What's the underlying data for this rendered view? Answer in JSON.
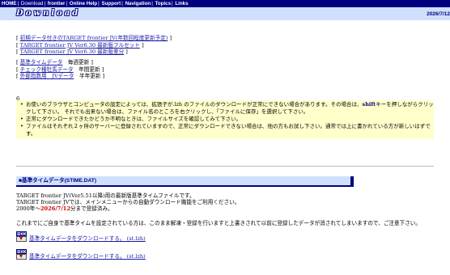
{
  "nav": {
    "items": [
      {
        "label": "HOME",
        "current": false
      },
      {
        "label": "Download",
        "current": true
      },
      {
        "label": "frontier",
        "current": false
      },
      {
        "label": "Online Help",
        "current": false
      },
      {
        "label": "Support",
        "current": false
      },
      {
        "label": "Navigation",
        "current": false
      },
      {
        "label": "Topics",
        "current": false
      },
      {
        "label": "Links",
        "current": false
      }
    ]
  },
  "header": {
    "logo": "Download",
    "date": "2026/7/12"
  },
  "downloads": [
    "初期データ付きのTARGET frontier JV(年数回程度更新予定)",
    "TARGET frontier JV Ver6.30 最新版フルセット",
    "TARGET frontier JV Ver6.30 最新版差分"
  ],
  "data_links": [
    {
      "label": "基準タイムデータ",
      "freq": "毎週更新"
    },
    {
      "label": "チェック種牡馬データ",
      "freq": "年間更新"
    },
    {
      "label": "外部指数用　JVデータ",
      "freq": "半年更新"
    }
  ],
  "notes": {
    "number": "6",
    "items": [
      {
        "pre": "お使いのブラウザとコンピュータの設定によっては、拡張子が.lzh のファイルのダウンロードが正常にできない場合があります。その場合は、",
        "key": "shift",
        "post": "キーを押しながらクリックして下さい。 それでも出来ない場合は、ファイル名のところを右クリックし、「ファイルに保存」を選択して下さい。"
      },
      {
        "pre": "正常にダウンロードできたかどうか不明なときは、ファイルサイズを確認してみて下さい。",
        "key": "",
        "post": ""
      },
      {
        "pre": "ファイルはそれぞれ２ヶ所のサーバーに登録されていますので、正常にダウンロードできない場合は、他の方もお試し下さい。通常では上に書かれている方が新しいはずです。",
        "key": "",
        "post": ""
      }
    ]
  },
  "section": {
    "title": "■基準タイムデータ(STIME.DAT)",
    "line1": "TARGET frontier JV(Ver5.51以降)用の最新版基準タイムファイルです。",
    "line2": "TARGET frontier JVでは、メインメニューからの自動ダウンロード機能をご利用ください。",
    "line3_pre": "2000年～",
    "line3_date": "2026/7/12",
    "line3_post": "分まで登録済み。",
    "warning": "これまでにご自身で基準タイムを設定されている方は、このまま解凍・登録を行いますと上書きされて以前に登録したデータが消されてしまいますので、ご注意下さい。",
    "download_links": [
      "基準タイムデータをダウンロードする。 (st.lzh)",
      "基準タイムデータをダウンロードする。 (st.lzh)"
    ],
    "icon_label": "HDD"
  }
}
